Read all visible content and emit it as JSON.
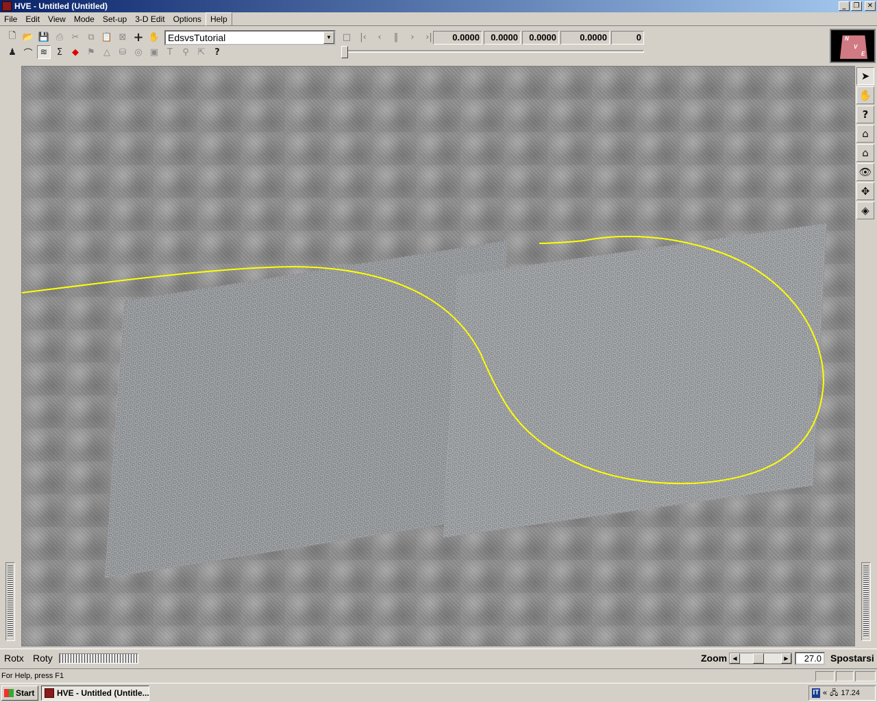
{
  "window": {
    "title": "HVE - Untitled (Untitled)",
    "controls": {
      "minimize": "_",
      "restore": "❐",
      "close": "✕"
    }
  },
  "menubar": {
    "items": [
      "File",
      "Edit",
      "View",
      "Mode",
      "Set-up",
      "3-D Edit",
      "Options",
      "Help"
    ],
    "active": "Help"
  },
  "toolbar": {
    "scene_select": {
      "value": "EdsvsTutorial"
    },
    "readouts": [
      "0.0000",
      "0.0000",
      "0.0000",
      "0.0000",
      "0"
    ],
    "row1_icons": [
      "new-icon",
      "open-icon",
      "save-icon",
      "print-icon",
      "cut-icon",
      "copy-icon",
      "paste-icon",
      "scale-icon",
      "add-icon",
      "hand-icon"
    ],
    "row2_icons": [
      "person-icon",
      "orbit-icon",
      "terrain-icon",
      "sigma-icon",
      "move-icon",
      "flag-icon",
      "warning-icon",
      "database-icon",
      "target-icon",
      "cube-icon",
      "text-icon",
      "pin-icon",
      "cursor-icon",
      "help-icon"
    ],
    "playback": [
      "stop-icon",
      "first-icon",
      "prev-icon",
      "pause-icon",
      "next-icon",
      "last-icon"
    ]
  },
  "logo": {
    "letters": [
      "N",
      "V",
      "E"
    ]
  },
  "right_tools": [
    "pointer-icon",
    "hand-icon",
    "help-icon",
    "home-icon",
    "home-set-icon",
    "view-icon",
    "move-icon",
    "cube-icon"
  ],
  "navbar": {
    "rotx_label": "Rotx",
    "roty_label": "Roty",
    "zoom_label": "Zoom",
    "zoom_value": "27.0",
    "spostarsi_label": "Spostarsi"
  },
  "statusbar": {
    "text": "For Help, press F1"
  },
  "taskbar": {
    "start_label": "Start",
    "task_item": "HVE - Untitled (Untitle...",
    "tray_lang": "IT",
    "tray_chevron": "«",
    "clock": "17.24"
  },
  "colors": {
    "curve": "#ffff00",
    "title_gradient_start": "#0a246a",
    "title_gradient_end": "#a6caf0",
    "chrome": "#d4d0c8"
  }
}
